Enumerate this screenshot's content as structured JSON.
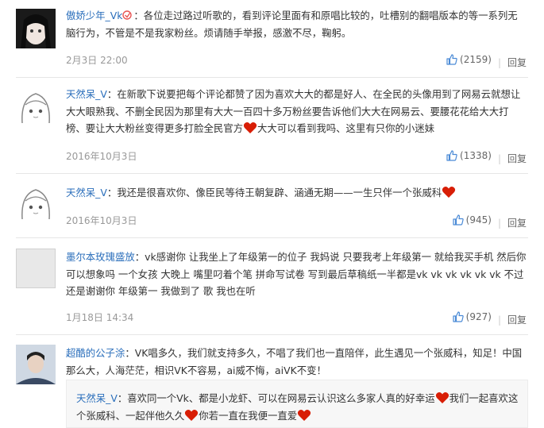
{
  "comments": [
    {
      "user": "傲娇少年_Vk",
      "text": "：各位走过路过听歌的，看到评论里面有和原唱比较的，吐槽别的翻唱版本的等一系列无脑行为，不管是不是我家粉丝。烦请随手举报，感激不尽，鞠躬。",
      "time": "2月3日 22:00",
      "likes": "(2159)",
      "reply": "回复"
    },
    {
      "user": "天然呆_V",
      "text_a": "：在新歌下说要把每个评论都赞了因为喜欢大大的都是好人、在全民的头像用到了网易云就想让大大眼熟我、不删全民因为那里有大大一百四十多万粉丝要告诉他们大大在网易云、要腰花花给大大打榜、要让大大粉丝变得更多打脸全民官方",
      "text_b": "大大可以看到我吗、这里有只你的小迷妹",
      "time": "2016年10月3日",
      "likes": "(1338)",
      "reply": "回复"
    },
    {
      "user": "天然呆_V",
      "text": "：我还是很喜欢你、像臣民等待王朝复辟、涵通无期——一生只伴一个张威科",
      "time": "2016年10月3日",
      "likes": "(945)",
      "reply": "回复"
    },
    {
      "user": "墨尔本玫瑰盛放",
      "text": "：vk感谢你 让我坐上了年级第一的位子 我妈说 只要我考上年级第一 就给我买手机 然后你可以想象吗 一个女孩 大晚上 嘴里叼着个笔 拼命写试卷 写到最后草稿纸一半都是vk vk vk vk vk vk 不过还是谢谢你 年级第一 我做到了 歌 我也在听",
      "time": "1月18日 14:34",
      "likes": "(927)",
      "reply": "回复"
    },
    {
      "user": "超酷的公子涂",
      "text": "：VK唱多久，我们就支持多久，不唱了我们也一直陪伴，此生遇见一个张威科，知足！中国那么大，人海茫茫，相识VK不容易，ai威不悔，aiVK不变！"
    }
  ],
  "nested_reply": {
    "user": "天然呆_V",
    "text_a": "：喜欢同一个Vk、都是小龙虾、可以在网易云认识这么多家人真的好幸运",
    "text_b": "我们一起喜欢这个张威科、一起伴他久久",
    "text_c": "你若一直在我便一直爱"
  },
  "colors": {
    "link": "#2a6ebb",
    "heart": "#d81e06",
    "meta": "#999999"
  }
}
